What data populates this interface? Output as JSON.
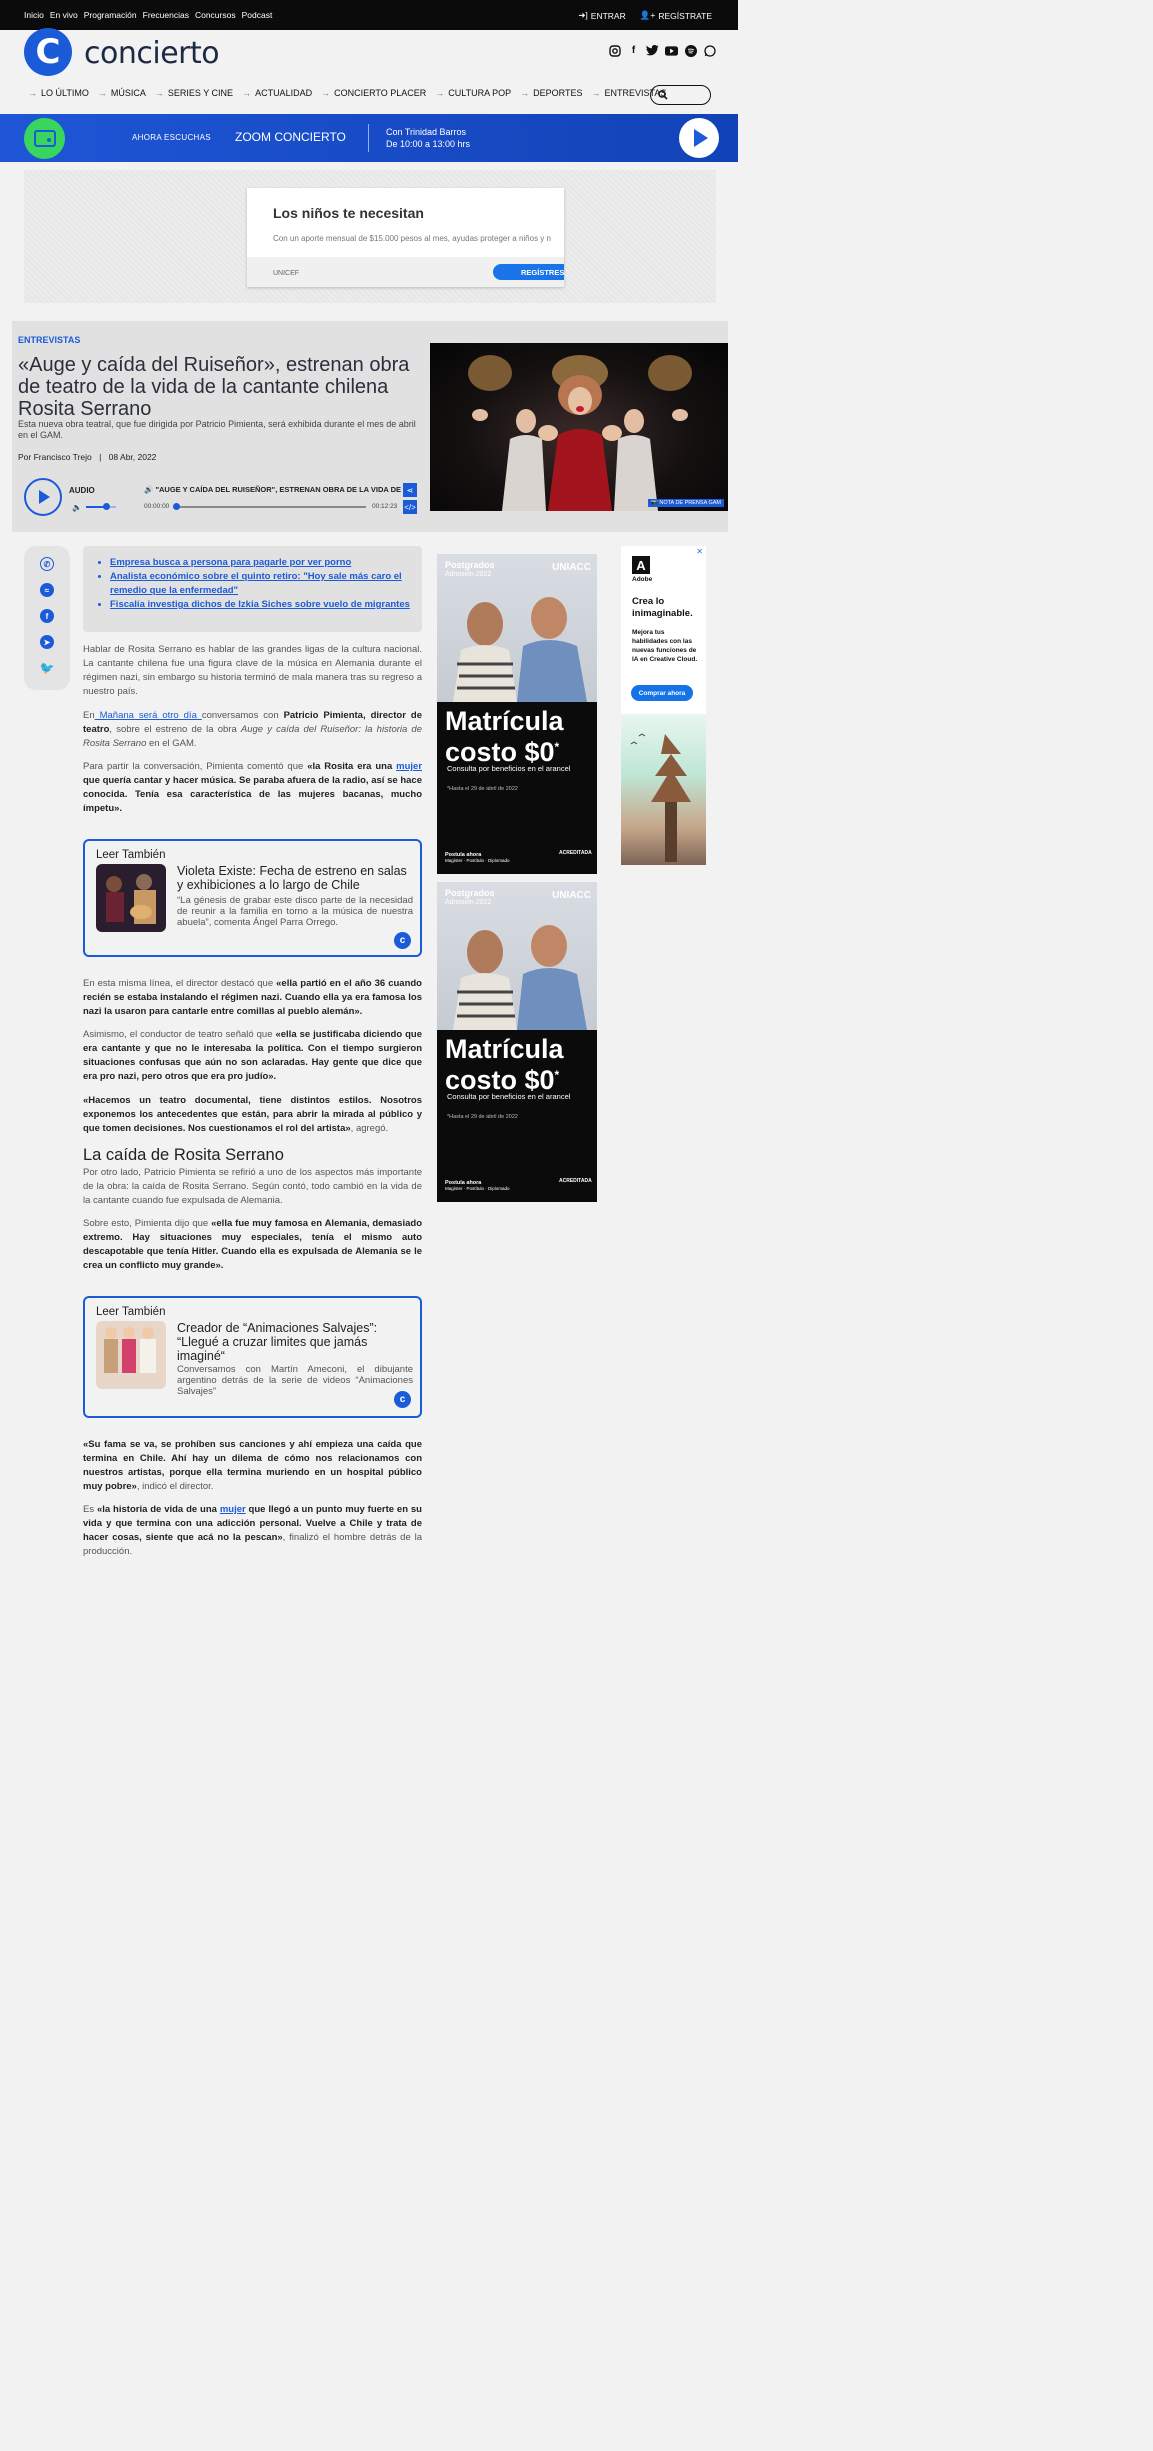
{
  "topbar": {
    "links": [
      "Inicio",
      "En vivo",
      "Programación",
      "Frecuencias",
      "Concursos",
      "Podcast"
    ],
    "login": "ENTRAR",
    "register": "REGÍSTRATE"
  },
  "header": {
    "logo_letter": "C",
    "logo_text": "concierto",
    "socials": [
      "instagram-icon",
      "facebook-icon",
      "twitter-icon",
      "youtube-icon",
      "spotify-icon",
      "whatsapp-icon"
    ]
  },
  "nav": {
    "items": [
      "LO ÚLTIMO",
      "MÚSICA",
      "SERIES Y CINE",
      "ACTUALIDAD",
      "CONCIERTO PLACER",
      "CULTURA POP",
      "DEPORTES",
      "ENTREVISTAS"
    ]
  },
  "radio": {
    "now_label": "AHORA ESCUCHAS",
    "show": "ZOOM CONCIERTO",
    "host": "Con Trinidad Barros",
    "schedule": "De 10:00 a 13:00 hrs"
  },
  "ad_banner": {
    "heading": "Los niños te necesitan",
    "text": "Con un aporte mensual de $15.000 pesos al mes, ayudas proteger a niños y n",
    "brand": "UNICEF",
    "cta": "REGÍSTRESE"
  },
  "article": {
    "category": "ENTREVISTAS",
    "title": "«Auge y caída del Ruiseñor», estrenan obra de teatro de la vida de la cantante chilena Rosita Serrano",
    "dek": "Esta nueva obra teatral, que fue dirigida por Patricio Pimienta, será exhibida durante el mes de abril en el GAM.",
    "author": "Por Francisco Trejo",
    "separator": "|",
    "date": "08 Abr, 2022",
    "photo_credit": "NOTA DE PRENSA GAM"
  },
  "audio": {
    "label": "AUDIO",
    "track": "\"AUGE Y CAÍDA DEL RUISEÑOR\", ESTRENAN OBRA DE LA VIDA DE",
    "current": "00:00:00",
    "duration": "00:12:23",
    "progress": 0,
    "volume": 0.67
  },
  "related": [
    "Empresa busca a persona para pagarle por ver porno",
    "Analista económico sobre el quinto retiro: \"Hoy sale más caro el remedio que la enfermedad\"",
    "Fiscalía investiga dichos de Izkia Siches sobre vuelo de migrantes"
  ],
  "body": {
    "p1": "Hablar de Rosita Serrano es hablar de las grandes ligas de la cultura nacional. La cantante chilena fue una figura clave de la música en Alemania durante el régimen nazi, sin embargo su historia terminó de mala manera tras su regreso a nuestro país.",
    "p2_a": "En",
    "p2_link": " Mañana será otro día ",
    "p2_b": "conversamos con ",
    "p2_bold": "Patricio Pimienta, director de teatro",
    "p2_c": ", sobre el estreno de la obra ",
    "p2_italic": "Auge y caída del Ruiseñor: la historia de Rosita Serrano",
    "p2_d": " en el GAM.",
    "p3_a": "Para partir la conversación, Pimienta comentó que ",
    "p3_bold_a": "«la Rosita era una ",
    "p3_link": "mujer",
    "p3_bold_b": " que quería cantar y hacer música. Se paraba afuera de la radio, así se hace conocida. Tenía esa característica de las mujeres bacanas, mucho ímpetu».",
    "p4_a": "En esta misma línea, el director destacó que ",
    "p4_bold": "«ella partió en el año 36 cuando recién se estaba instalando el régimen nazi. Cuando ella ya era famosa los nazi la usaron para cantarle entre comillas al pueblo alemán».",
    "p5_a": "Asimismo, el conductor de teatro señaló que ",
    "p5_bold": "«ella se justificaba diciendo que era cantante y que no le interesaba la política. Con el tiempo surgieron situaciones confusas que aún no son aclaradas. Hay gente que dice que era pro nazi, pero otros que era pro judío».",
    "p6_bold": "«Hacemos un teatro documental, tiene distintos estilos. Nosotros exponemos los antecedentes que están, para abrir la mirada al público y que tomen decisiones. Nos cuestionamos el rol del artista»",
    "p6_b": ", agregó.",
    "h2": "La caída de Rosita Serrano",
    "p7": "Por otro lado, Patricio Pimienta se refirió a uno de los aspectos más importante de la obra: la caída de Rosita Serrano. Según contó, todo cambió en la vida de la cantante cuando fue expulsada de Alemania.",
    "p8_a": "Sobre esto, Pimienta dijo que ",
    "p8_bold": "«ella fue muy famosa en Alemania, demasiado extremo. Hay situaciones muy especiales, tenía el mismo auto descapotable que tenía Hitler. Cuando ella es expulsada de Alemania se le crea un conflicto muy grande».",
    "p9_bold": "«Su fama se va, se prohíben sus canciones y ahí empieza una caída que termina en Chile. Ahí hay un dilema de cómo nos relacionamos con nuestros artistas, porque ella termina muriendo en un hospital público muy pobre»",
    "p9_b": ", indicó el director.",
    "p10_a": "Es ",
    "p10_bold_a": "«la historia de vida de una ",
    "p10_link": "mujer",
    "p10_bold_b": " que llegó a un punto muy fuerte en su vida y que termina con una adicción personal. Vuelve a Chile y trata de hacer cosas, siente que acá no la pescan»",
    "p10_b": ", finalizó el hombre detrás de la producción."
  },
  "leer1": {
    "label": "Leer También",
    "title": "Violeta Existe: Fecha de estreno en salas y exhibiciones a lo largo de Chile",
    "desc": "“La génesis de grabar este disco parte de la necesidad de reunir a la familia en torno a la música de nuestra abuela”, comenta Ángel Parra Orrego."
  },
  "leer2": {
    "label": "Leer También",
    "title": "Creador de “Animaciones Salvajes”: “Llegué a cruzar limites que jamás imaginé“",
    "desc": "Conversamos con Martín Ameconi, el dibujante argentino detrás de la serie de videos “Animaciones Salvajes”"
  },
  "ad_uniacc": {
    "kicker": "Postgrados",
    "kicker_sub": "Admisión 2022",
    "brand": "UNIACC",
    "headline_1": "Matrícula",
    "headline_2": "costo $0",
    "headline_mark": "*",
    "sub": "Consulta por beneficios en el arancel",
    "note": "*Hasta el 29 de abril de 2022",
    "cta": "Postula ahora",
    "cta_sub": "Magíster · Postítulo · Diplomado",
    "badge": "ACREDITADA"
  },
  "ad_adobe": {
    "logo_letter": "A",
    "logo_name": "Adobe",
    "headline": "Crea lo inimaginable.",
    "text": "Mejora tus habilidades con las nuevas funciones de IA en Creative Cloud.",
    "cta": "Comprar ahora",
    "close": "✕"
  },
  "colors": {
    "brand": "#1c5bd8",
    "radio_green": "#39d65f",
    "dark": "#0b0b0b"
  }
}
